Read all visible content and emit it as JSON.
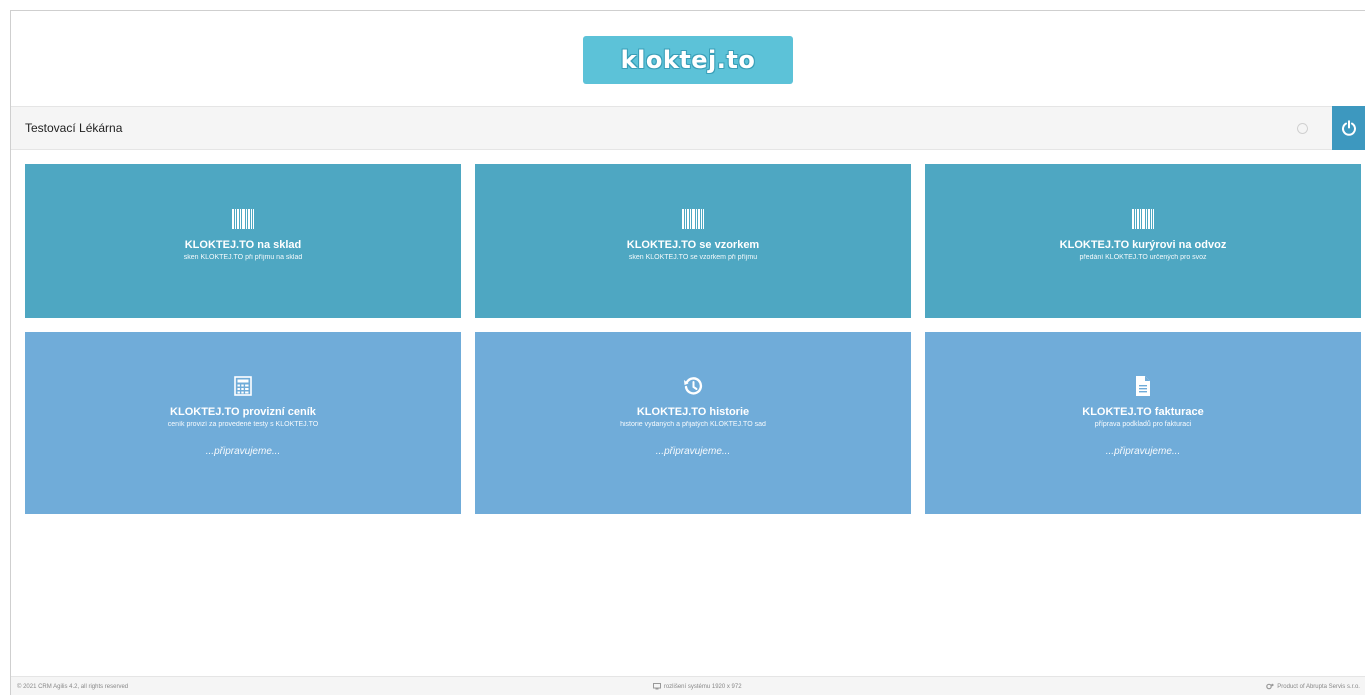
{
  "header": {
    "logo_text": "kloktej.to"
  },
  "topbar": {
    "pharmacy_name": "Testovací Lékárna"
  },
  "tiles": [
    {
      "icon": "barcode-icon",
      "title": "KLOKTEJ.TO na sklad",
      "desc": "sken KLOKTEJ.TO při příjmu na sklad",
      "pending": ""
    },
    {
      "icon": "barcode-icon",
      "title": "KLOKTEJ.TO se vzorkem",
      "desc": "sken KLOKTEJ.TO se vzorkem při příjmu",
      "pending": ""
    },
    {
      "icon": "barcode-icon",
      "title": "KLOKTEJ.TO kurýrovi na odvoz",
      "desc": "předání KLOKTEJ.TO určených pro svoz",
      "pending": ""
    },
    {
      "icon": "calculator-icon",
      "title": "KLOKTEJ.TO provizní ceník",
      "desc": "ceník provizí za provedené testy s KLOKTEJ.TO",
      "pending": "...připravujeme..."
    },
    {
      "icon": "history-icon",
      "title": "KLOKTEJ.TO historie",
      "desc": "historie vydaných a přijatých KLOKTEJ.TO sad",
      "pending": "...připravujeme..."
    },
    {
      "icon": "document-icon",
      "title": "KLOKTEJ.TO fakturace",
      "desc": "příprava podkladů pro fakturaci",
      "pending": "...připravujeme..."
    }
  ],
  "footer": {
    "copyright": "© 2021 CRM Agilis 4.2, all rights reserved",
    "resolution": "rozlišení systému 1920 x 972",
    "product": "Product of Abrupta Servis s.r.o."
  },
  "colors": {
    "logo": "#5cc2d8",
    "row1": "#4ea7c2",
    "row2": "#70acd9",
    "power": "#3d98bf"
  }
}
